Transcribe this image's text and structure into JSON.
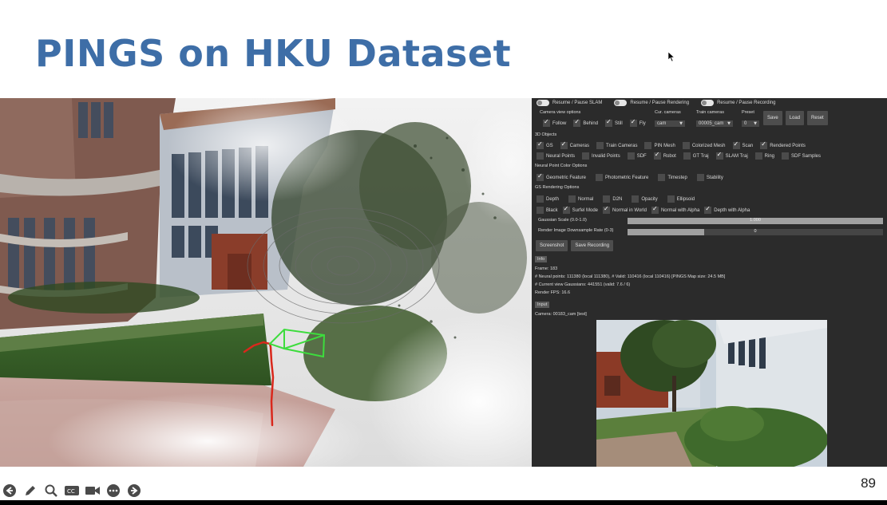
{
  "slide": {
    "title": "PINGS on HKU Dataset",
    "page_number": "89"
  },
  "gui": {
    "toggles": [
      {
        "label": "Resume / Pause SLAM"
      },
      {
        "label": "Resume / Pause Rendering"
      },
      {
        "label": "Resume / Pause Recording"
      }
    ],
    "camera_view_options": {
      "heading": "Camera view options",
      "items": [
        {
          "label": "Follow",
          "checked": true
        },
        {
          "label": "Behind",
          "checked": true
        },
        {
          "label": "Still",
          "checked": true
        },
        {
          "label": "Fly",
          "checked": true
        }
      ]
    },
    "cur_cameras": {
      "label": "Cur. cameras",
      "value": "cam"
    },
    "train_cameras": {
      "label": "Train cameras",
      "value": "00005_cam"
    },
    "preset": {
      "label": "Preset",
      "value": "0"
    },
    "buttons": {
      "save": "Save",
      "load": "Load",
      "reset": "Reset"
    },
    "objects_3d": {
      "heading": "3D Objects",
      "row1": [
        {
          "label": "GS",
          "checked": true
        },
        {
          "label": "Cameras",
          "checked": true
        },
        {
          "label": "Train Cameras",
          "checked": false
        },
        {
          "label": "PIN Mesh",
          "checked": false
        },
        {
          "label": "Colorized Mesh",
          "checked": false
        },
        {
          "label": "Scan",
          "checked": true
        },
        {
          "label": "Rendered Points",
          "checked": true
        }
      ],
      "row2": [
        {
          "label": "Neural Points",
          "checked": false
        },
        {
          "label": "Invalid Points",
          "checked": false
        },
        {
          "label": "SDF",
          "checked": false
        },
        {
          "label": "Robot",
          "checked": true
        },
        {
          "label": "GT Traj",
          "checked": false
        },
        {
          "label": "SLAM Traj",
          "checked": true
        },
        {
          "label": "Ring",
          "checked": false
        },
        {
          "label": "SDF Samples",
          "checked": false
        }
      ]
    },
    "neural_color": {
      "heading": "Neural Point Color Options",
      "items": [
        {
          "label": "Geometric Feature",
          "checked": true
        },
        {
          "label": "Photometric Feature",
          "checked": false
        },
        {
          "label": "Timestep",
          "checked": false
        },
        {
          "label": "Stability",
          "checked": false
        }
      ]
    },
    "gs_rendering": {
      "heading": "GS Rendering Options",
      "row1": [
        {
          "label": "Depth",
          "checked": false
        },
        {
          "label": "Normal",
          "checked": false
        },
        {
          "label": "D2N",
          "checked": false
        },
        {
          "label": "Opacity",
          "checked": false
        },
        {
          "label": "Ellipsoid",
          "checked": false
        }
      ],
      "row2": [
        {
          "label": "Black",
          "checked": false
        },
        {
          "label": "Surfel Mode",
          "checked": true
        },
        {
          "label": "Normal in World",
          "checked": true
        },
        {
          "label": "Normal with Alpha",
          "checked": true
        },
        {
          "label": "Depth with Alpha",
          "checked": true
        }
      ]
    },
    "gaussian_scale": {
      "label": "Gaussian Scale (0.0-1.0)",
      "value": "1.000",
      "fraction": 1.0
    },
    "downsample": {
      "label": "Render Image Downsample Rate (0-3)",
      "value": "0",
      "fraction": 0.3
    },
    "action_buttons": {
      "screenshot": "Screenshot",
      "save_recording": "Save Recording"
    },
    "info_tag": "Info",
    "info_lines": [
      "Frame: 183",
      "# Neural points: 111380 (local 111380), # Valid: 110416 (local 110416) [PINGS Map size: 24.5 MB]",
      "# Current view Gaussians: 441551 (valid: 7.6 / 6)",
      "Render FPS: 16.6"
    ],
    "input_tag": "Input",
    "camera_line": "Camera: 00183_cam [test]"
  },
  "toolbar_icons": [
    "back-arrow-icon",
    "pen-icon",
    "zoom-icon",
    "captions-icon",
    "video-icon",
    "more-icon",
    "forward-arrow-icon"
  ],
  "colors": {
    "title": "#3e6ea7",
    "gui_background": "#2b2b2b",
    "trajectory": "#d9281c",
    "camera_frustum": "#3ddc3d"
  }
}
